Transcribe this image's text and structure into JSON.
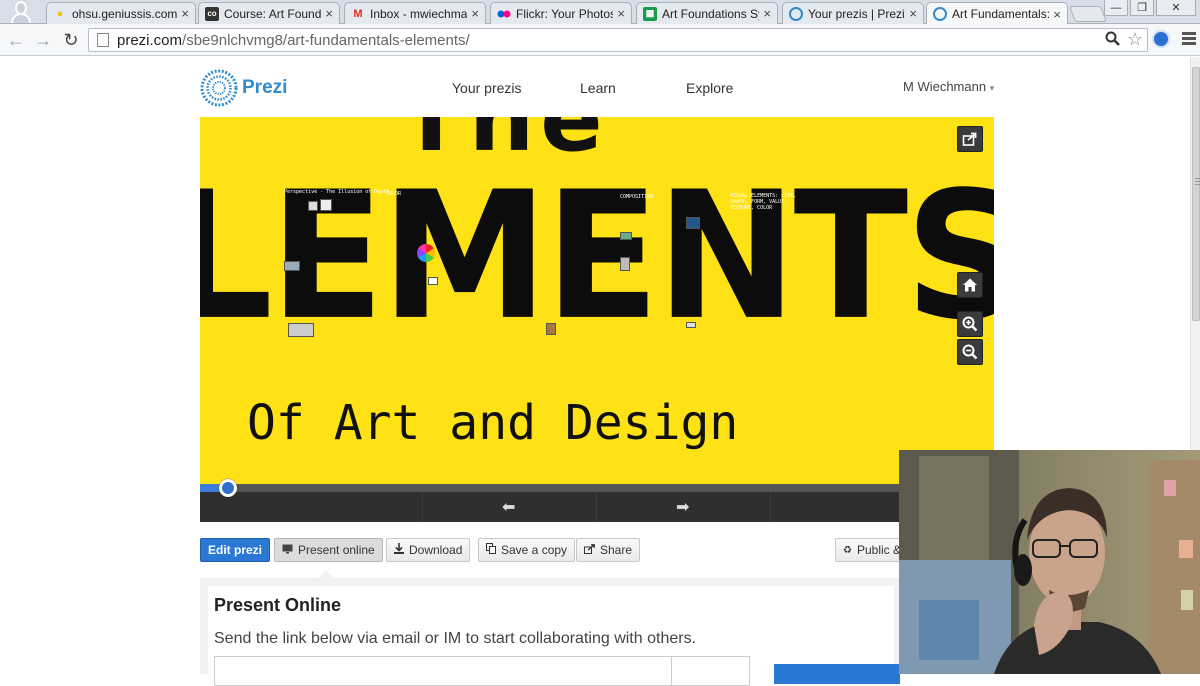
{
  "browser": {
    "tabs": [
      {
        "title": "ohsu.geniussis.com",
        "favicon": "bulb-icon",
        "active": false
      },
      {
        "title": "Course: Art Foundations",
        "favicon": "course-icon",
        "active": false
      },
      {
        "title": "Inbox - mwiechmann",
        "favicon": "gmail-icon",
        "active": false
      },
      {
        "title": "Flickr: Your Photostream",
        "favicon": "flickr-icon",
        "active": false
      },
      {
        "title": "Art Foundations Syllabus",
        "favicon": "sheets-icon",
        "active": false
      },
      {
        "title": "Your prezis | Prezi",
        "favicon": "prezi-icon",
        "active": false
      },
      {
        "title": "Art Fundamentals: Elements",
        "favicon": "prezi-icon",
        "active": true
      }
    ],
    "tab_close": "×",
    "url_host": "prezi.com",
    "url_path": "/sbe9nlchvmg8/art-fundamentals-elements/",
    "icons": {
      "back": "←",
      "forward": "→",
      "reload": "↻",
      "search": "⚲",
      "star": "☆",
      "minimize": "—",
      "maximize": "❐",
      "close": "✕"
    }
  },
  "prezi": {
    "logo_text": "Prezi",
    "nav": {
      "your_prezis": "Your prezis",
      "learn": "Learn",
      "explore": "Explore"
    },
    "user": {
      "name": "M Wiechmann",
      "caret": "▾"
    },
    "canvas": {
      "the_word": "The",
      "elements_word": "LEMENTS",
      "subtitle": "Of Art and Design",
      "panels": {
        "perspective": "Perspective - The Illusion of Depth",
        "color": "COLOR",
        "composition": "COMPOSITION",
        "line_shapes": "VISUAL ELEMENTS: LINE, SHAPE, FORM, VALUE, TEXTURE, COLOR"
      },
      "background_color": "#ffe215"
    },
    "player": {
      "progress": 0.04,
      "prev": "⬅",
      "next": "➡"
    },
    "actions": {
      "edit": "Edit prezi",
      "present_online": "Present online",
      "download": "Download",
      "save_copy": "Save a copy",
      "share": "Share",
      "public": "Public &"
    },
    "present_online_panel": {
      "heading": "Present Online",
      "description": "Send the link below via email or IM to start collaborating with others."
    }
  },
  "colors": {
    "prezi_blue": "#318bce",
    "button_blue": "#2a78d4",
    "canvas_yellow": "#ffe215"
  }
}
